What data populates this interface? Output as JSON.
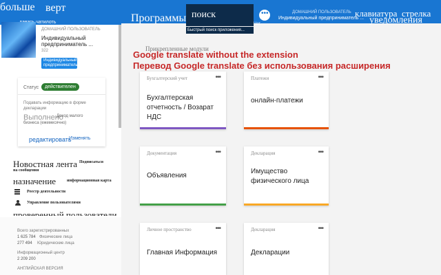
{
  "topbar": {
    "nav_more": "больше",
    "nav_vert": "верт",
    "programs": "Программы",
    "search_label": "поиск",
    "search_tooltip": "Быстрый поиск приложения...",
    "chat_label": "Чат",
    "user_role": "ДОМАШНИЙ ПОЛЬЗОВАТЕЛЬ",
    "user_name": "Индивидуальный предприниматель ...",
    "keyboard": "клавиатура",
    "arrow": "стрелка",
    "notifications": "уведомления",
    "nav_cut": "давать чатилоть"
  },
  "sidebar": {
    "user_role": "ДОМАШНИЙ ПОЛЬЗОВАТЕЛЬ",
    "user_name_1": "Индивидуальный",
    "user_name_2": "предприниматель ...",
    "user_id": "322",
    "badge_1": "Индивидуальный",
    "badge_2": "предприниматель",
    "status_label": "Статус",
    "status_value": "действителен",
    "submit_1": "Подавать информацию в форме",
    "submit_2": "декларации",
    "done_label": "Выполнено",
    "income_1": "Доход малого",
    "income_2": "бизнеса (ежемесячно)",
    "edit_link": "редактировать",
    "edit_link_2": "Изменять",
    "news_feed": "Новостная лента",
    "subscribe": "Подписаться",
    "on_messages": "на сообщения",
    "assignment": "назначение",
    "info_map": "информационная карта",
    "registry": "Реестр деятельности",
    "user_mgmt": "Управление пользователями",
    "check_users": "проверенный пользователи",
    "total_registered": "Всего зарегистрированных",
    "individuals_count": "1 625 784",
    "individuals_label": "Физические лица",
    "legal_count": "277 494",
    "legal_label": "Юридические лица",
    "info_center": "Информационный центр",
    "info_phone": "2 209 200",
    "english_version": "АНГЛИЙСКАЯ ВЕРСИЯ"
  },
  "main": {
    "pinned_modules": "Прикрепленные модули",
    "overlay_en": "Google translate without the extension",
    "overlay_ru": "Перевод Google translate без использования расширения",
    "cards": [
      {
        "category": "Бухгалтерский учет",
        "title": "Бухгалтерская отчетность / Возарат НДС",
        "color": "#7e57c2"
      },
      {
        "category": "Платежи",
        "title": "онлайн-платежи",
        "color": "#e65100"
      },
      {
        "category": "Документация",
        "title": "Объявления",
        "color": "#43a047"
      },
      {
        "category": "Декларация",
        "title": "Имущество физического лица",
        "color": "#f9a825"
      },
      {
        "category": "Личное пространство",
        "title": "Главная Информация",
        "color": "#1e88e5"
      },
      {
        "category": "Декларация",
        "title": "Декларации",
        "color": "#1e88e5"
      }
    ],
    "dots": "•••"
  }
}
